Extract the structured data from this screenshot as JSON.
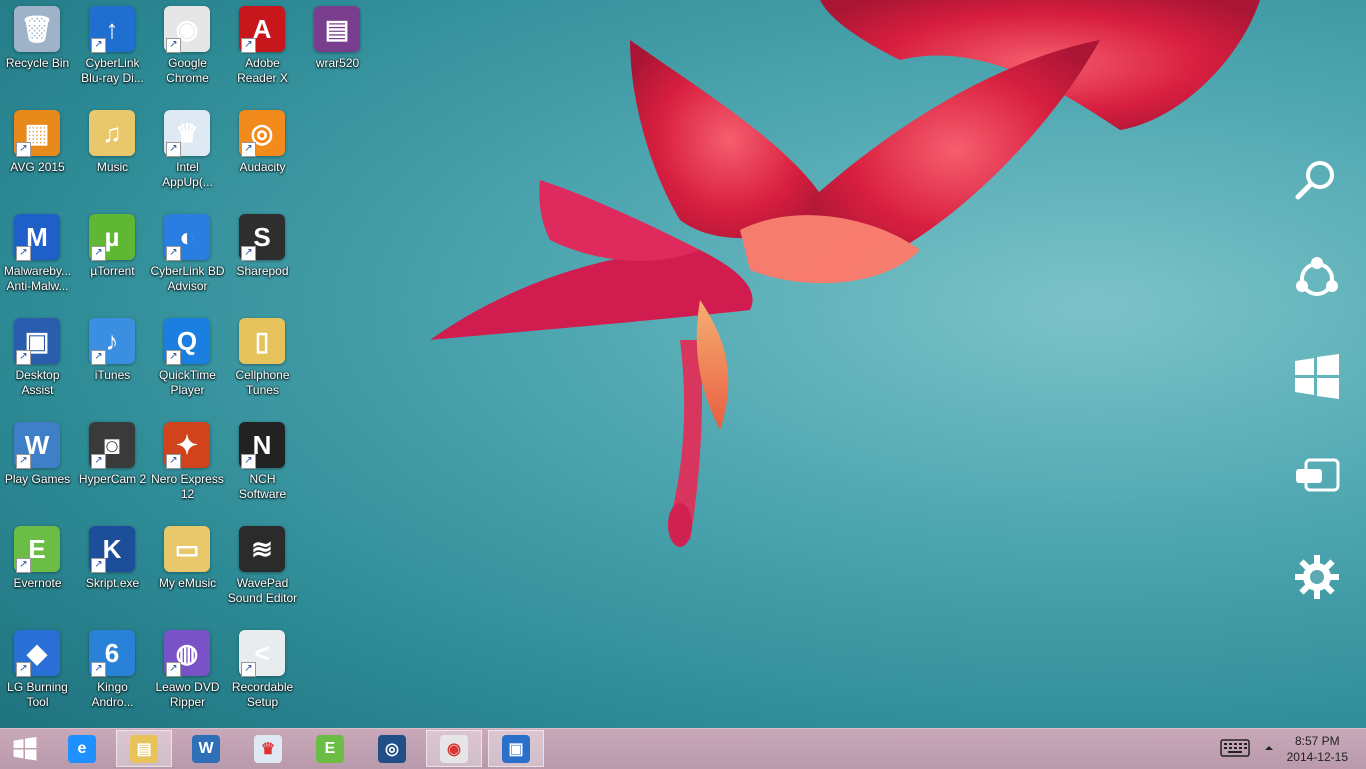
{
  "desktop": {
    "icons": [
      {
        "label": "Recycle Bin",
        "icon": "recycle-bin-icon",
        "color": "#9fb3c8",
        "glyph": "🗑",
        "shortcut": false
      },
      {
        "label": "CyberLink\nBlu-ray Di...",
        "icon": "cyberlink-bluray-icon",
        "color": "#1f6fd1",
        "glyph": "↑",
        "shortcut": true
      },
      {
        "label": "Google\nChrome",
        "icon": "chrome-icon",
        "color": "#e6e6e6",
        "glyph": "◉",
        "shortcut": true
      },
      {
        "label": "Adobe\nReader X",
        "icon": "adobe-reader-icon",
        "color": "#c8161d",
        "glyph": "A",
        "shortcut": true
      },
      {
        "label": "wrar520",
        "icon": "winrar-icon",
        "color": "#7a3e8e",
        "glyph": "▤",
        "shortcut": false
      },
      {
        "label": "AVG 2015",
        "icon": "avg-icon",
        "color": "#e88a1b",
        "glyph": "▦",
        "shortcut": true
      },
      {
        "label": "Music",
        "icon": "folder-icon",
        "color": "#e8c86a",
        "glyph": "♫",
        "shortcut": false
      },
      {
        "label": "Intel\nAppUp(...",
        "icon": "intel-appup-icon",
        "color": "#dfe9f3",
        "glyph": "♛",
        "shortcut": true
      },
      {
        "label": "Audacity",
        "icon": "audacity-icon",
        "color": "#f28b1c",
        "glyph": "◎",
        "shortcut": true
      },
      {
        "label": "Malwareby...\nAnti-Malw...",
        "icon": "malwarebytes-icon",
        "color": "#1e5fc8",
        "glyph": "M",
        "shortcut": true
      },
      {
        "label": "µTorrent",
        "icon": "utorrent-icon",
        "color": "#5fb733",
        "glyph": "µ",
        "shortcut": true
      },
      {
        "label": "CyberLink BD\nAdvisor",
        "icon": "cyberlink-bd-advisor-icon",
        "color": "#2a7de1",
        "glyph": "◐",
        "shortcut": true
      },
      {
        "label": "Sharepod",
        "icon": "sharepod-icon",
        "color": "#2e2e2e",
        "glyph": "S",
        "shortcut": true
      },
      {
        "label": "Desktop\nAssist",
        "icon": "desktop-assist-icon",
        "color": "#2b5dae",
        "glyph": "▣",
        "shortcut": true
      },
      {
        "label": "iTunes",
        "icon": "itunes-icon",
        "color": "#3a8fe0",
        "glyph": "♪",
        "shortcut": true
      },
      {
        "label": "QuickTime\nPlayer",
        "icon": "quicktime-icon",
        "color": "#1a7fe0",
        "glyph": "Q",
        "shortcut": true
      },
      {
        "label": "Cellphone\nTunes",
        "icon": "folder-icon",
        "color": "#e6c35a",
        "glyph": "▯",
        "shortcut": false
      },
      {
        "label": "Play Games",
        "icon": "wild-games-icon",
        "color": "#3f7fc8",
        "glyph": "W",
        "shortcut": true
      },
      {
        "label": "HyperCam 2",
        "icon": "hypercam-icon",
        "color": "#3a3a3a",
        "glyph": "◙",
        "shortcut": true
      },
      {
        "label": "Nero Express\n12",
        "icon": "nero-express-icon",
        "color": "#d1431d",
        "glyph": "✦",
        "shortcut": true
      },
      {
        "label": "NCH\nSoftware",
        "icon": "nch-software-icon",
        "color": "#222222",
        "glyph": "N",
        "shortcut": true
      },
      {
        "label": "Evernote",
        "icon": "evernote-icon",
        "color": "#6cbd45",
        "glyph": "E",
        "shortcut": true
      },
      {
        "label": "Skript.exe",
        "icon": "skript-icon",
        "color": "#1d4e9a",
        "glyph": "K",
        "shortcut": true
      },
      {
        "label": "My eMusic",
        "icon": "folder-icon",
        "color": "#e8c86a",
        "glyph": "▭",
        "shortcut": false
      },
      {
        "label": "WavePad\nSound Editor",
        "icon": "wavepad-icon",
        "color": "#2b2b2b",
        "glyph": "≋",
        "shortcut": false
      },
      {
        "label": "LG Burning\nTool",
        "icon": "lg-burning-tool-icon",
        "color": "#2a6fd6",
        "glyph": "◆",
        "shortcut": true
      },
      {
        "label": "Kingo\nAndro...",
        "icon": "kingo-root-icon",
        "color": "#2a82d8",
        "glyph": "6",
        "shortcut": true
      },
      {
        "label": "Leawo DVD\nRipper",
        "icon": "leawo-dvd-icon",
        "color": "#7a52c8",
        "glyph": "◍",
        "shortcut": true
      },
      {
        "label": "Recordable\nSetup",
        "icon": "recordable-setup-icon",
        "color": "#e9ecef",
        "glyph": "<",
        "shortcut": true
      }
    ]
  },
  "charms": [
    {
      "name": "search",
      "icon": "search-icon"
    },
    {
      "name": "share",
      "icon": "share-icon"
    },
    {
      "name": "start",
      "icon": "windows-start-icon"
    },
    {
      "name": "devices",
      "icon": "devices-icon"
    },
    {
      "name": "settings",
      "icon": "gear-icon"
    }
  ],
  "taskbar": {
    "items": [
      {
        "icon": "windows-start-icon",
        "color": "#ffffff",
        "glyph": "⊞",
        "active": false
      },
      {
        "icon": "internet-explorer-icon",
        "color": "#1e90ff",
        "glyph": "e",
        "active": false
      },
      {
        "icon": "file-explorer-icon",
        "color": "#e8c35a",
        "glyph": "▤",
        "active": true
      },
      {
        "icon": "wild-games-icon",
        "color": "#2f6fb8",
        "glyph": "W",
        "active": false
      },
      {
        "icon": "intel-appup-icon",
        "color": "#dfe9f3",
        "glyph": "♛",
        "active": false
      },
      {
        "icon": "evernote-icon",
        "color": "#6cbd45",
        "glyph": "E",
        "active": false
      },
      {
        "icon": "media-player-icon",
        "color": "#1f4f86",
        "glyph": "◎",
        "active": false
      },
      {
        "icon": "chrome-icon",
        "color": "#e6e6e6",
        "glyph": "◉",
        "active": true
      },
      {
        "icon": "remote-desktop-icon",
        "color": "#2a6fc9",
        "glyph": "▣",
        "active": true
      }
    ],
    "tray": {
      "keyboard_icon": "touch-keyboard-icon",
      "show_hidden_icon": "chevron-up-icon",
      "time": "8:57 PM",
      "date": "2014-12-15"
    }
  }
}
